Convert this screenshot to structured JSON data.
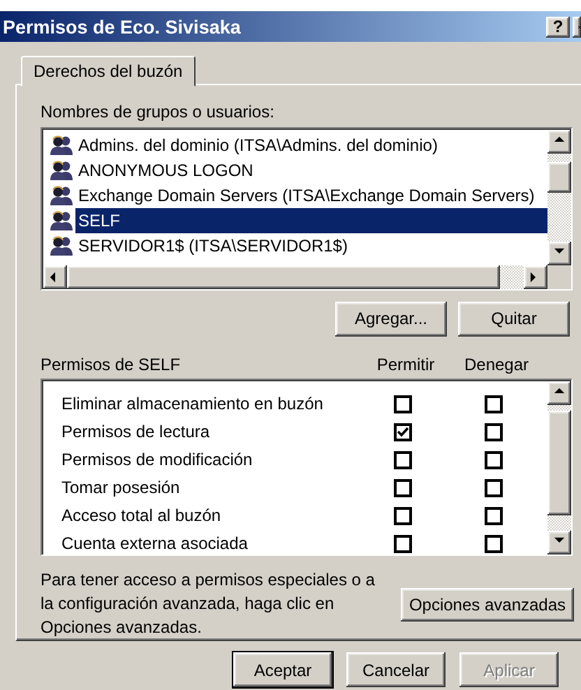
{
  "window": {
    "title": "Permisos de Eco. Sivisaka",
    "help_button": "?"
  },
  "tabs": [
    {
      "label": "Derechos del buzón",
      "selected": true
    }
  ],
  "users": {
    "label": "Nombres de grupos o usuarios:",
    "items": [
      {
        "name": "Admins. del dominio (ITSA\\Admins. del dominio)",
        "selected": false
      },
      {
        "name": "ANONYMOUS LOGON",
        "selected": false
      },
      {
        "name": "Exchange Domain Servers (ITSA\\Exchange Domain Servers)",
        "selected": false
      },
      {
        "name": "SELF",
        "selected": true
      },
      {
        "name": "SERVIDOR1$ (ITSA\\SERVIDOR1$)",
        "selected": false
      }
    ]
  },
  "user_buttons": [
    {
      "label": "Agregar..."
    },
    {
      "label": "Quitar"
    }
  ],
  "permissions": {
    "label": "Permisos de SELF",
    "columns": [
      "Permitir",
      "Denegar"
    ],
    "rows": [
      {
        "name": "Eliminar almacenamiento en buzón",
        "allow": false,
        "deny": false
      },
      {
        "name": "Permisos de lectura",
        "allow": true,
        "deny": false
      },
      {
        "name": "Permisos de modificación",
        "allow": false,
        "deny": false
      },
      {
        "name": "Tomar posesión",
        "allow": false,
        "deny": false
      },
      {
        "name": "Acceso total al buzón",
        "allow": false,
        "deny": false
      },
      {
        "name": "Cuenta externa asociada",
        "allow": false,
        "deny": false
      }
    ]
  },
  "advanced": {
    "text": "Para tener acceso a permisos especiales o a la configuración avanzada, haga clic en Opciones avanzadas.",
    "button": "Opciones avanzadas"
  },
  "buttons": [
    {
      "label": "Aceptar",
      "default": true,
      "disabled": false
    },
    {
      "label": "Cancelar",
      "default": false,
      "disabled": false
    },
    {
      "label": "Aplicar",
      "default": false,
      "disabled": true
    }
  ]
}
